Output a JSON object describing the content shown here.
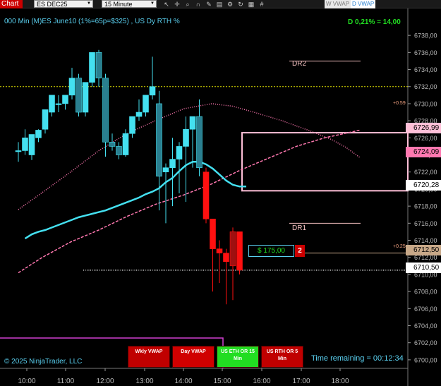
{
  "toolbar": {
    "chart_tab": "Chart",
    "instrument": "ES DEC25",
    "interval": "15 Minute",
    "tab_w_vwap": "W VWAP",
    "tab_d_vwap": "D VWAP",
    "icons": [
      "cursor-icon",
      "crosshair-icon",
      "zoom-icon",
      "magnet-icon",
      "draw-icon",
      "layers-icon",
      "settings-icon",
      "refresh-icon",
      "grid-icon",
      "hash-icon"
    ]
  },
  "chart": {
    "title": "000 Min (M)ES June10 (1%=65p=$325) , US Dy RTH %",
    "pnl": "D 0,21% = 14,00",
    "copyright": "© 2025 NinjaTrader, LLC",
    "time_remaining": "Time remaining = 00:12:34",
    "dr2": "DR2",
    "dr1": "DR1",
    "label_059": "+0.59",
    "label_025": "+0.25",
    "position_pnl": "$ 175,00",
    "position_qty": "2",
    "price_tags": [
      {
        "value": "6726,99",
        "bg": "#ffc0d8",
        "fg": "#000"
      },
      {
        "value": "6724,09",
        "bg": "#ff78b0",
        "fg": "#000"
      },
      {
        "value": "6720,28",
        "bg": "#ffffff",
        "fg": "#000"
      },
      {
        "value": "6712,50",
        "bg": "#c8a888",
        "fg": "#000"
      },
      {
        "value": "6710,50",
        "bg": "#ffffff",
        "fg": "#000"
      }
    ],
    "buttons": [
      {
        "l1": "Wkly VWAP",
        "l2": "",
        "bg": "#c00000"
      },
      {
        "l1": "Day VWAP",
        "l2": "",
        "bg": "#d00000"
      },
      {
        "l1": "US ETH OR 15",
        "l2": "Min",
        "bg": "#22dd22"
      },
      {
        "l1": "US RTH OR 5",
        "l2": "Min",
        "bg": "#c00000"
      }
    ]
  },
  "chart_data": {
    "type": "candlestick",
    "y_ticks": [
      "6738,00",
      "6736,00",
      "6734,00",
      "6732,00",
      "6730,00",
      "6728,00",
      "6726,00",
      "6724,00",
      "6722,00",
      "6720,00",
      "6718,00",
      "6716,00",
      "6714,00",
      "6712,00",
      "6710,00",
      "6708,00",
      "6706,00",
      "6704,00",
      "6702,00",
      "6700,00"
    ],
    "ylim": [
      6699,
      6739.5
    ],
    "x_ticks": [
      "10:00",
      "11:00",
      "12:00",
      "13:00",
      "14:00",
      "15:00",
      "16:00",
      "17:00",
      "18:00"
    ],
    "candles": [
      {
        "o": 6724.5,
        "h": 6725.5,
        "c": 6724.5,
        "l": 6723.2
      },
      {
        "o": 6724.5,
        "h": 6727.0,
        "c": 6726.0,
        "l": 6724.0
      },
      {
        "o": 6724.0,
        "h": 6726.4,
        "c": 6726.4,
        "l": 6723.4
      },
      {
        "o": 6726.0,
        "h": 6727.0,
        "c": 6726.9,
        "l": 6725.5
      },
      {
        "o": 6727.0,
        "h": 6729.3,
        "c": 6729.3,
        "l": 6726.5
      },
      {
        "o": 6729.0,
        "h": 6731.0,
        "c": 6731.0,
        "l": 6728.5
      },
      {
        "o": 6730.0,
        "h": 6731.0,
        "c": 6730.0,
        "l": 6729.0
      },
      {
        "o": 6730.0,
        "h": 6731.0,
        "c": 6731.0,
        "l": 6729.3
      },
      {
        "o": 6731.0,
        "h": 6734.2,
        "c": 6733.0,
        "l": 6730.5
      },
      {
        "o": 6733.0,
        "h": 6733.5,
        "c": 6729.0,
        "l": 6728.5
      },
      {
        "o": 6729.0,
        "h": 6732.5,
        "c": 6732.5,
        "l": 6728.5
      },
      {
        "o": 6732.5,
        "h": 6736.0,
        "c": 6736.0,
        "l": 6732.0
      },
      {
        "o": 6736.0,
        "h": 6736.3,
        "c": 6733.0,
        "l": 6732.0
      },
      {
        "o": 6733.0,
        "h": 6733.5,
        "c": 6725.5,
        "l": 6723.8
      },
      {
        "o": 6725.5,
        "h": 6726.5,
        "c": 6725.0,
        "l": 6724.5
      },
      {
        "o": 6725.0,
        "h": 6725.5,
        "c": 6724.0,
        "l": 6723.5
      },
      {
        "o": 6724.0,
        "h": 6727.0,
        "c": 6726.5,
        "l": 6723.8
      },
      {
        "o": 6726.5,
        "h": 6728.5,
        "c": 6728.5,
        "l": 6726.0
      },
      {
        "o": 6728.5,
        "h": 6730.5,
        "c": 6729.0,
        "l": 6728.0
      },
      {
        "o": 6729.0,
        "h": 6731.0,
        "c": 6731.0,
        "l": 6728.5
      },
      {
        "o": 6731.0,
        "h": 6735.5,
        "c": 6732.0,
        "l": 6730.5
      },
      {
        "o": 6730.0,
        "h": 6731.5,
        "c": 6721.5,
        "l": 6717.5
      },
      {
        "o": 6722.0,
        "h": 6723.0,
        "c": 6722.5,
        "l": 6716.0
      },
      {
        "o": 6722.5,
        "h": 6726.0,
        "c": 6723.5,
        "l": 6718.0
      },
      {
        "o": 6723.5,
        "h": 6725.5,
        "c": 6725.0,
        "l": 6719.5
      },
      {
        "o": 6725.0,
        "h": 6728.5,
        "c": 6727.0,
        "l": 6718.5
      },
      {
        "o": 6727.0,
        "h": 6728.5,
        "c": 6728.5,
        "l": 6722.5
      },
      {
        "o": 6728.5,
        "h": 6730.5,
        "c": 6722.5,
        "l": 6721.5
      },
      {
        "o": 6722.0,
        "h": 6722.5,
        "c": 6716.5,
        "l": 6716.0
      },
      {
        "o": 6716.5,
        "h": 6716.5,
        "c": 6713.0,
        "l": 6708.0
      },
      {
        "o": 6713.0,
        "h": 6714.0,
        "c": 6712.5,
        "l": 6709.0
      },
      {
        "o": 6712.5,
        "h": 6713.0,
        "c": 6711.5,
        "l": 6706.5
      },
      {
        "o": 6711.0,
        "h": 6715.5,
        "c": 6715.0,
        "l": 6707.0
      },
      {
        "o": 6715.0,
        "h": 6715.0,
        "c": 6710.5,
        "l": 6710.0
      }
    ],
    "vwap_cyan": [
      6714.2,
      6714.7,
      6715.0,
      6715.2,
      6715.5,
      6715.8,
      6716.1,
      6716.4,
      6716.7,
      6716.9,
      6717.1,
      6717.3,
      6717.5,
      6717.8,
      6718.1,
      6718.4,
      6718.7,
      6719.0,
      6719.4,
      6719.7,
      6720.1,
      6720.8,
      6721.3,
      6722.1,
      6722.8,
      6723.2,
      6723.2,
      6722.9,
      6722.4,
      6721.7,
      6721.0,
      6720.5,
      6720.3,
      6720.3
    ]
  }
}
